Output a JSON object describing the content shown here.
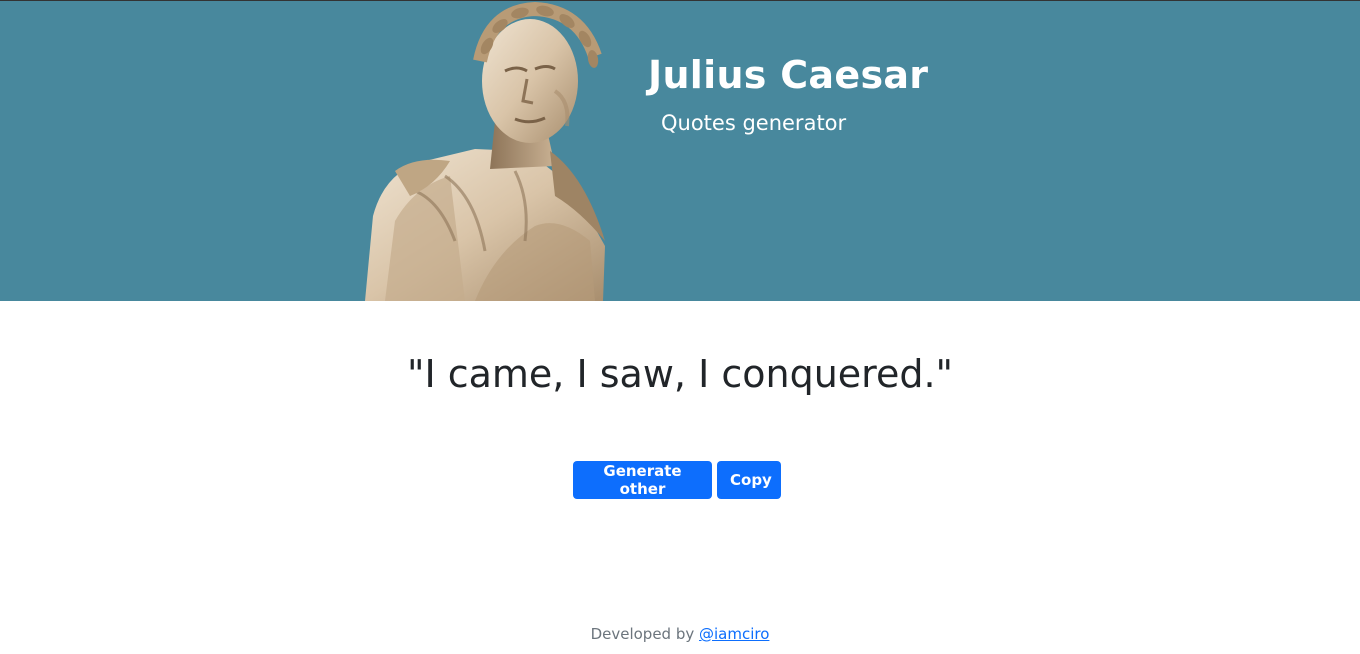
{
  "header": {
    "title": "Julius Caesar",
    "subtitle": "Quotes generator",
    "background_color": "#48889d",
    "statue_image": "julius-caesar-statue"
  },
  "main": {
    "quote": "\"I came, I saw, I conquered.\"",
    "generate_label": "Generate other",
    "copy_label": "Copy",
    "button_color": "#0d6efd"
  },
  "footer": {
    "prefix": "Developed by",
    "link_text": "@iamciro"
  }
}
